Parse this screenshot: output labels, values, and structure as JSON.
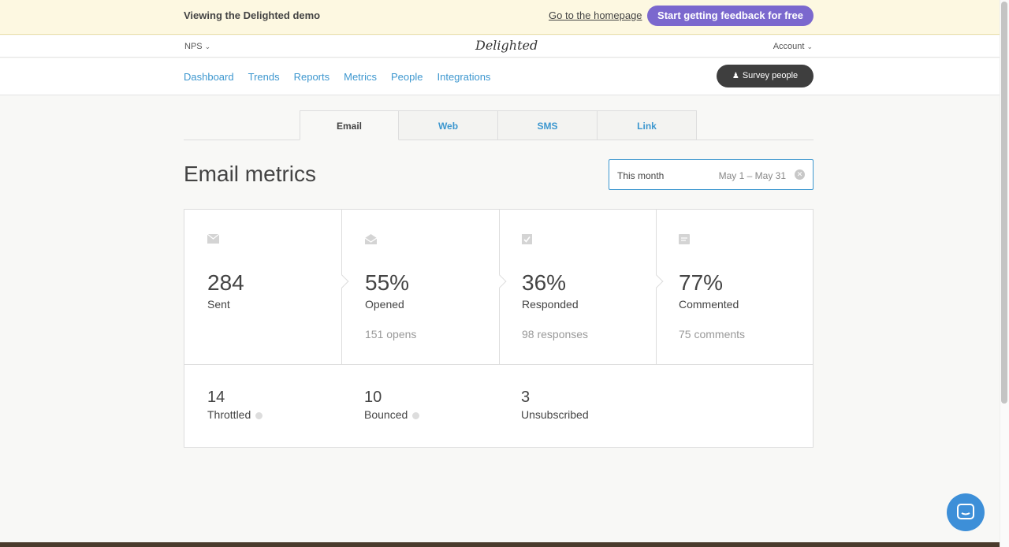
{
  "demo_bar": {
    "title": "Viewing the Delighted demo",
    "home_link": "Go to the homepage",
    "cta": "Start getting feedback for free"
  },
  "topbar": {
    "product": "NPS",
    "logo": "Delighted",
    "account": "Account"
  },
  "nav": {
    "items": [
      "Dashboard",
      "Trends",
      "Reports",
      "Metrics",
      "People",
      "Integrations"
    ],
    "survey_button": "Survey people"
  },
  "tabs": [
    "Email",
    "Web",
    "SMS",
    "Link"
  ],
  "active_tab": "Email",
  "page_title": "Email metrics",
  "date_range": {
    "label": "This month",
    "range": "May 1 – May 31"
  },
  "metrics": [
    {
      "icon": "envelope-icon",
      "value": "284",
      "name": "Sent",
      "sub": ""
    },
    {
      "icon": "open-envelope-icon",
      "value": "55%",
      "name": "Opened",
      "sub": "151 opens"
    },
    {
      "icon": "checkbox-icon",
      "value": "36%",
      "name": "Responded",
      "sub": "98 responses"
    },
    {
      "icon": "comment-icon",
      "value": "77%",
      "name": "Commented",
      "sub": "75 comments"
    }
  ],
  "secondary_metrics": [
    {
      "value": "14",
      "name": "Throttled"
    },
    {
      "value": "10",
      "name": "Bounced"
    },
    {
      "value": "3",
      "name": "Unsubscribed"
    }
  ],
  "colors": {
    "accent_blue": "#3d97cf",
    "cta_purple": "#7b68ce",
    "demo_bar_bg": "#fdf8e1",
    "chat_blue": "#3d8fd8"
  }
}
